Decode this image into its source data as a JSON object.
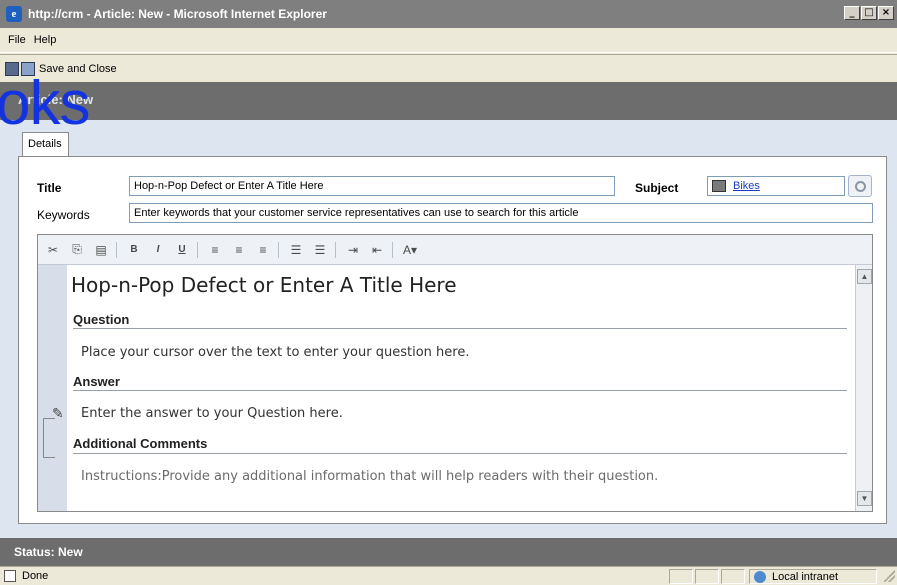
{
  "window": {
    "title": "http://crm - Article: New - Microsoft Internet Explorer",
    "minimize": "_",
    "maximize": "□",
    "close": "×"
  },
  "menu": {
    "items": [
      "File",
      "Help"
    ]
  },
  "toolbar": {
    "save_close_label": "Save and Close"
  },
  "form": {
    "header_title": "Article: New",
    "watermark_text": "oks",
    "tab_label": "Details",
    "title_label": "Title",
    "title_value": "Hop-n-Pop Defect or Enter A Title Here",
    "subject_label": "Subject",
    "subject_value": "Bikes",
    "keywords_label": "Keywords",
    "keywords_value": "Enter keywords that your customer service representatives can use to search for this article"
  },
  "editor": {
    "toolbar_icons": [
      "cut-icon",
      "copy-icon",
      "paste-icon",
      "bold-icon",
      "italic-icon",
      "underline-icon",
      "align-left-icon",
      "align-center-icon",
      "align-right-icon",
      "numbered-list-icon",
      "bulleted-list-icon",
      "increase-indent-icon",
      "decrease-indent-icon",
      "font-color-icon"
    ],
    "article_title": "Hop-n-Pop Defect or Enter A Title Here",
    "question_head": "Question",
    "question_text": "Place your cursor over the text to enter your question here.",
    "answer_head": "Answer",
    "answer_text": "Enter the answer to your Question here.",
    "comments_head": "Additional Comments",
    "comments_text": "Instructions:Provide any additional information that will help readers with their question."
  },
  "status": {
    "form_status": "Status: New",
    "browser_status": "Done",
    "zone": "Local intranet"
  }
}
